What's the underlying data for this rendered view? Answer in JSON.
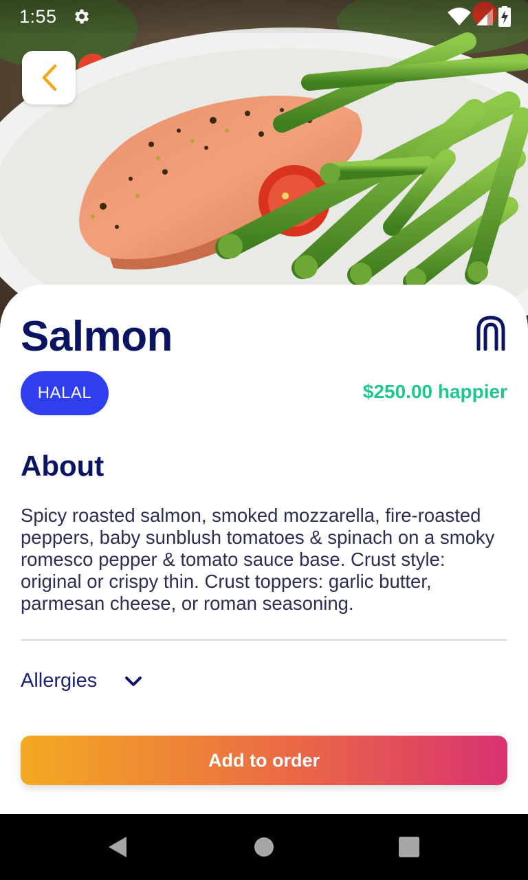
{
  "status_bar": {
    "time": "1:55"
  },
  "dish": {
    "name": "Salmon",
    "badge": "HALAL",
    "price_text": "$250.00 happier"
  },
  "about": {
    "heading": "About",
    "description": "Spicy roasted salmon, smoked mozzarella, fire-roasted peppers, baby sunblush tomatoes & spinach on a smoky romesco pepper & tomato sauce base. Crust style: original or crispy thin. Crust toppers: garlic butter, parmesan cheese, or roman seasoning."
  },
  "allergies": {
    "label": "Allergies"
  },
  "actions": {
    "add_to_order": "Add to order"
  },
  "colors": {
    "title": "#0b1463",
    "badge_bg": "#2f3ff0",
    "price": "#1ec88a",
    "button_gradient_start": "#f3aa22",
    "button_gradient_end": "#d93270",
    "back_chevron": "#f2a81d"
  },
  "icons": {
    "back": "chevron-left-icon",
    "favorite": "arch-bookmark-icon",
    "allergies_toggle": "chevron-down-icon",
    "status_settings": "gear-icon",
    "wifi": "wifi-icon",
    "signal": "cell-signal-icon",
    "battery": "battery-charging-icon"
  }
}
